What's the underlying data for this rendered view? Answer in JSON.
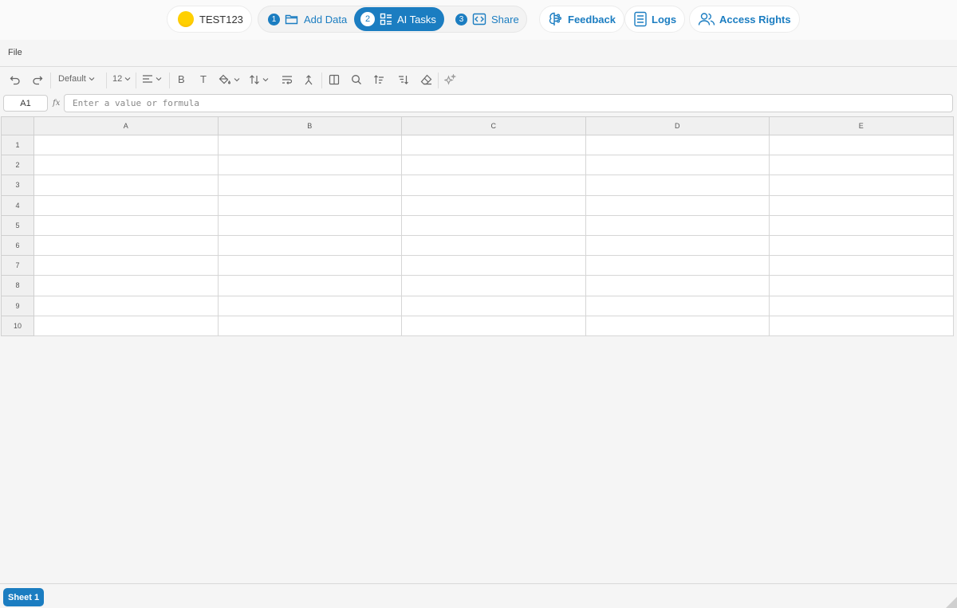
{
  "header": {
    "project_name": "TEST123",
    "steps": [
      {
        "number": "1",
        "label": "Add Data"
      },
      {
        "number": "2",
        "label": "AI Tasks"
      },
      {
        "number": "3",
        "label": "Share"
      }
    ],
    "active_step": "2",
    "feedback_label": "Feedback",
    "logs_label": "Logs",
    "access_label": "Access Rights"
  },
  "menu": {
    "file_label": "File"
  },
  "toolbar": {
    "font_name": "Default",
    "font_size": "12",
    "bold_label": "B",
    "text_label": "T"
  },
  "formula_bar": {
    "cell_ref": "A1",
    "fx_label": "fx",
    "placeholder": "Enter a value or formula"
  },
  "grid": {
    "columns": [
      "A",
      "B",
      "C",
      "D",
      "E"
    ],
    "rows": [
      "1",
      "2",
      "3",
      "4",
      "5",
      "6",
      "7",
      "8",
      "9",
      "10"
    ]
  },
  "sheets": [
    {
      "name": "Sheet 1",
      "active": true
    }
  ],
  "colors": {
    "accent": "#1b7dc1",
    "project_dot": "#ffd000"
  }
}
